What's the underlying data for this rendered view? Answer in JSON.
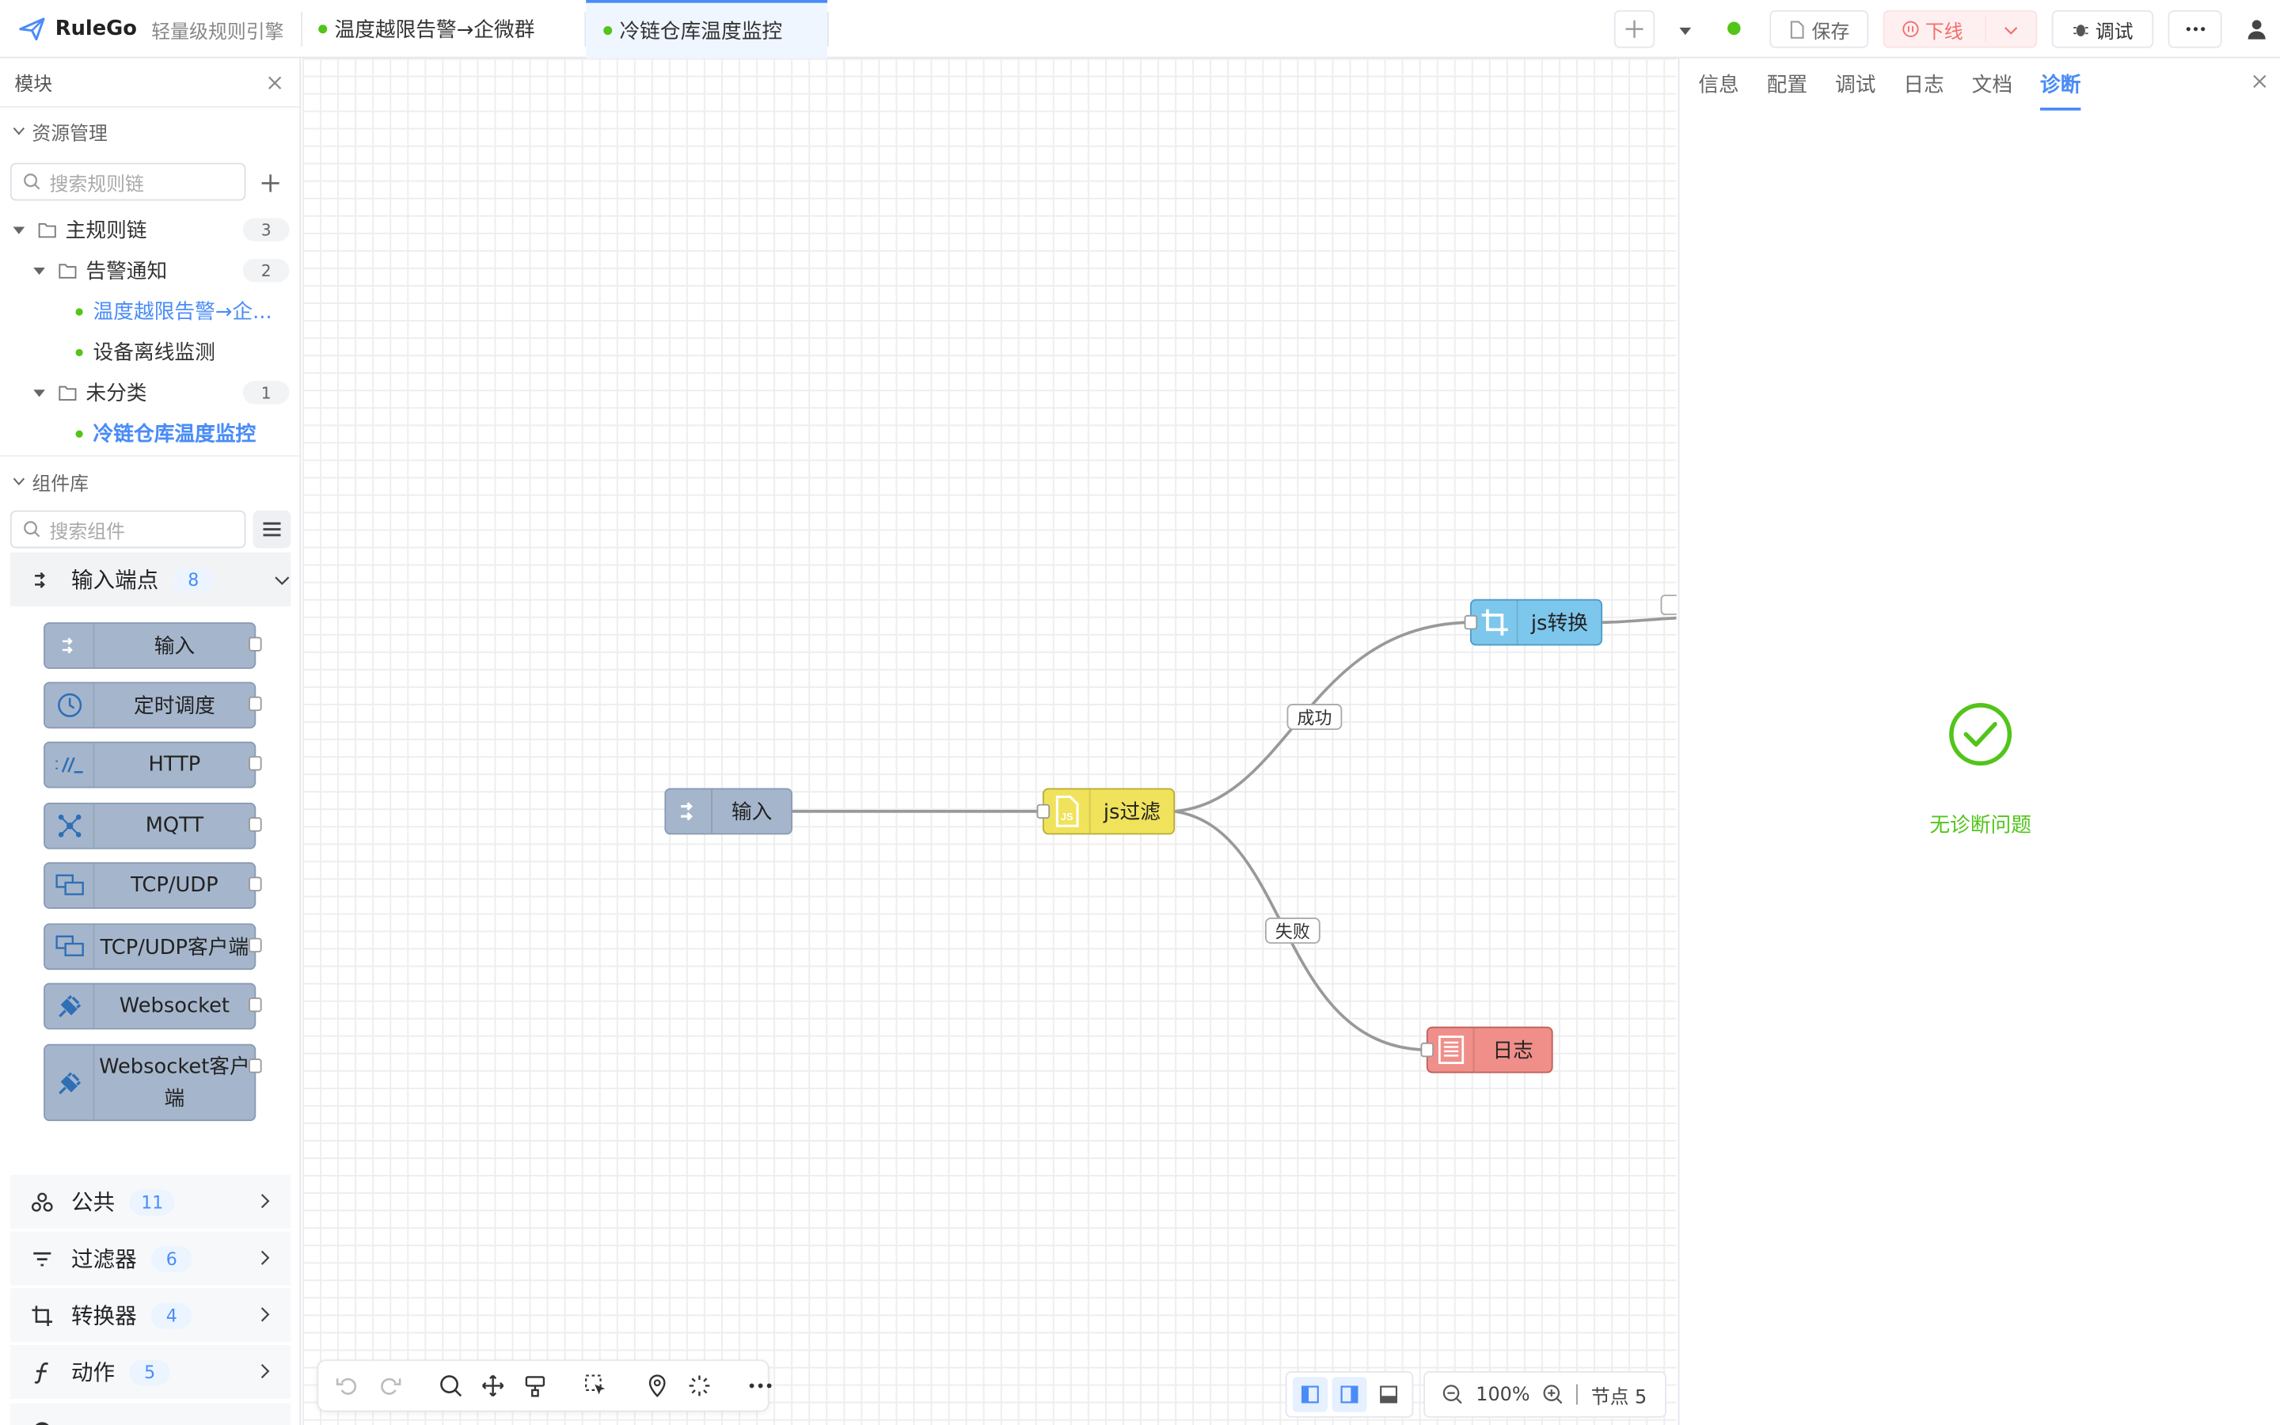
{
  "app": {
    "name": "RuleGo",
    "subtitle": "轻量级规则引擎"
  },
  "tabs": [
    {
      "label": "温度越限告警→企微群"
    },
    {
      "label": "冷链仓库温度监控"
    }
  ],
  "toolbar_right": {
    "save_label": "保存",
    "offline_label": "下线",
    "debug_label": "调试"
  },
  "sidebar": {
    "header": "模块",
    "resources_title": "资源管理",
    "search_chain_placeholder": "搜索规则链",
    "tree": {
      "main": {
        "label": "主规则链",
        "count": "3"
      },
      "alarm": {
        "label": "告警通知",
        "count": "2"
      },
      "alarm_items": [
        "温度越限告警→企...",
        "设备离线监测"
      ],
      "uncat": {
        "label": "未分类",
        "count": "1"
      },
      "uncat_items": [
        "冷链仓库温度监控"
      ]
    },
    "components_title": "组件库",
    "search_comp_placeholder": "搜索组件",
    "input_category": {
      "label": "输入端点",
      "count": "8"
    },
    "input_components": [
      "输入",
      "定时调度",
      "HTTP",
      "MQTT",
      "TCP/UDP",
      "TCP/UDP客户端",
      "Websocket",
      "Websocket客户端"
    ],
    "categories": [
      {
        "label": "公共",
        "count": "11"
      },
      {
        "label": "过滤器",
        "count": "6"
      },
      {
        "label": "转换器",
        "count": "4"
      },
      {
        "label": "动作",
        "count": "5"
      }
    ]
  },
  "canvas": {
    "nodes": {
      "input": "输入",
      "filter": "js过滤",
      "transform": "js转换",
      "log": "日志"
    },
    "edges": {
      "success": "成功",
      "failure": "失败"
    },
    "zoom": "100%",
    "nodes_count": "节点 5"
  },
  "right_panel": {
    "tabs": [
      "信息",
      "配置",
      "调试",
      "日志",
      "文档",
      "诊断"
    ],
    "active_tab": "诊断",
    "status_text": "无诊断问题"
  },
  "colors": {
    "accent": "#4a8cf7",
    "success": "#52c41a",
    "node_input": "#a5b6cc",
    "node_filter": "#f0e35b",
    "node_transform": "#7dc7ec",
    "node_log": "#f08f8a"
  }
}
